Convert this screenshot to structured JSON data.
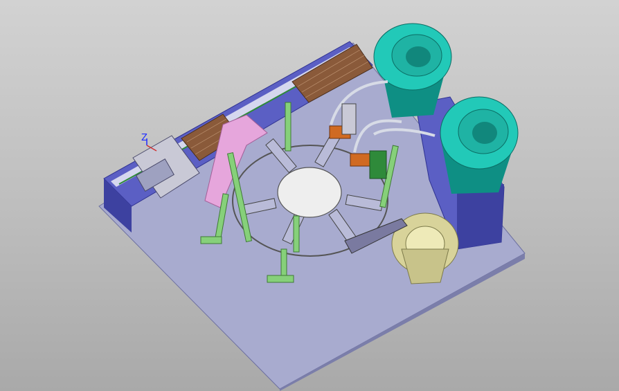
{
  "viewport": {
    "background_top": "#d2d2d2",
    "background_bottom": "#a9a9a9",
    "triad_axis_label": "Z"
  },
  "colors": {
    "baseplate": "#a8abcf",
    "frame": "#5b5fc4",
    "frame_dark": "#3d41a0",
    "feeder_bowl": "#22c9b8",
    "feeder_bowl_dark": "#0e8f84",
    "small_bowl": "#d8d39a",
    "pink_guard": "#e6a6dc",
    "green_posts": "#86d07a",
    "rotary_table": "#eeeeee",
    "conveyor_brown": "#8a5a3a"
  },
  "icons": [
    "axis-triad-icon"
  ]
}
